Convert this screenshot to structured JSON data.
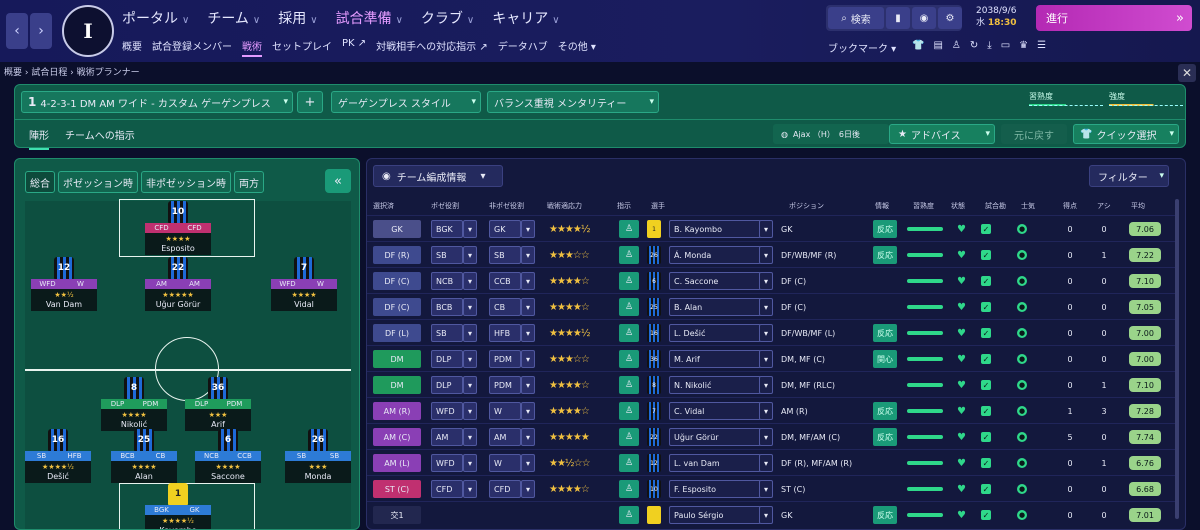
{
  "nav": {
    "back": "‹",
    "forward": "›",
    "club_logo_text": "I",
    "main": [
      {
        "label": "ポータル",
        "active": false
      },
      {
        "label": "チーム",
        "active": false
      },
      {
        "label": "採用",
        "active": false
      },
      {
        "label": "試合準備",
        "active": true
      },
      {
        "label": "クラブ",
        "active": false
      },
      {
        "label": "キャリア",
        "active": false
      }
    ],
    "sub": [
      {
        "label": "概要",
        "active": false
      },
      {
        "label": "試合登録メンバー",
        "active": false
      },
      {
        "label": "戦術",
        "active": true
      },
      {
        "label": "セットプレイ",
        "active": false
      },
      {
        "label": "PK ↗",
        "active": false
      },
      {
        "label": "対戦相手への対応指示 ↗",
        "active": false
      },
      {
        "label": "データハブ",
        "active": false
      },
      {
        "label": "その他 ▾",
        "active": false
      }
    ],
    "search_label": "検索",
    "date_line": "2038/9/6",
    "day": "水",
    "time": "18:30",
    "continue_label": "進行",
    "continue_arrow": "»",
    "bookmark_label": "ブックマーク ▾"
  },
  "breadcrumb": "概要 › 試合日程 › 戦術プランナー",
  "tactics": {
    "formation_num": "1",
    "formation": "4-2-3-1 DM AM ワイド - カスタム ゲーゲンプレス",
    "add": "+",
    "style": "ゲーゲンプレス  スタイル",
    "mentality": "バランス重視  メンタリティー",
    "familiarity_label": "習熟度",
    "strength_label": "強度",
    "tab_formation": "陣形",
    "tab_instructions": "チームへの指示",
    "opponent": "Ajax （H）　6日後",
    "advice": "アドバイス",
    "reset": "元に戻す",
    "quick_select": "クイック選択"
  },
  "pitch": {
    "tabs": [
      "総合",
      "ポゼッション時",
      "非ポゼッション時",
      "両方"
    ],
    "collapse": "«",
    "players": [
      {
        "num": "10",
        "r1": "CFD",
        "r2": "CFD",
        "stars": "★★★★",
        "name": "Esposito",
        "c": "red"
      },
      {
        "num": "12",
        "r1": "WFD",
        "r2": "W",
        "stars": "★★½",
        "name": "Van Dam",
        "c": "pur"
      },
      {
        "num": "22",
        "r1": "AM",
        "r2": "AM",
        "stars": "★★★★★",
        "name": "Uğur Görür",
        "c": "pur"
      },
      {
        "num": "7",
        "r1": "WFD",
        "r2": "W",
        "stars": "★★★★",
        "name": "Vidal",
        "c": "pur"
      },
      {
        "num": "8",
        "r1": "DLP",
        "r2": "PDM",
        "stars": "★★★★",
        "name": "Nikolić",
        "c": "grn"
      },
      {
        "num": "36",
        "r1": "DLP",
        "r2": "PDM",
        "stars": "★★★",
        "name": "Arif",
        "c": "grn"
      },
      {
        "num": "16",
        "r1": "SB",
        "r2": "HFB",
        "stars": "★★★★½",
        "name": "Dešić",
        "c": "blue"
      },
      {
        "num": "25",
        "r1": "BCB",
        "r2": "CB",
        "stars": "★★★★",
        "name": "Alan",
        "c": "blue"
      },
      {
        "num": "6",
        "r1": "NCB",
        "r2": "CCB",
        "stars": "★★★★",
        "name": "Saccone",
        "c": "blue"
      },
      {
        "num": "26",
        "r1": "SB",
        "r2": "SB",
        "stars": "★★★",
        "name": "Monda",
        "c": "blue"
      },
      {
        "num": "1",
        "r1": "BGK",
        "r2": "GK",
        "stars": "★★★★½",
        "name": "Kayombo",
        "c": "blue"
      }
    ]
  },
  "table": {
    "team_info": "チーム編成情報",
    "filter": "フィルター",
    "headers": [
      "選択済",
      "ポゼ役割",
      "非ポゼ役割",
      "戦術適応力",
      "指示",
      "選手",
      "ポジション",
      "情報",
      "習熟度",
      "状態",
      "試合勘",
      "士気",
      "得点",
      "アシ",
      "平均"
    ],
    "rows": [
      {
        "pos": "GK",
        "cls": "c-gk",
        "r1": "BGK",
        "r2": "GK",
        "stars": "★★★★½",
        "kit": "1",
        "gk": true,
        "name": "B. Kayombo",
        "ppos": "GK",
        "info": "反応",
        "g": "0",
        "a": "0",
        "avg": "7.06"
      },
      {
        "pos": "DF (R)",
        "cls": "c-df",
        "r1": "SB",
        "r2": "SB",
        "stars": "★★★☆☆",
        "kit": "26",
        "gk": false,
        "name": "Á. Monda",
        "ppos": "DF/WB/MF (R)",
        "info": "反応",
        "g": "0",
        "a": "1",
        "avg": "7.22"
      },
      {
        "pos": "DF (C)",
        "cls": "c-df",
        "r1": "NCB",
        "r2": "CCB",
        "stars": "★★★★☆",
        "kit": "6",
        "gk": false,
        "name": "C. Saccone",
        "ppos": "DF (C)",
        "info": "",
        "g": "0",
        "a": "0",
        "avg": "7.10"
      },
      {
        "pos": "DF (C)",
        "cls": "c-df",
        "r1": "BCB",
        "r2": "CB",
        "stars": "★★★★☆",
        "kit": "25",
        "gk": false,
        "name": "B. Alan",
        "ppos": "DF (C)",
        "info": "",
        "g": "0",
        "a": "0",
        "avg": "7.05"
      },
      {
        "pos": "DF (L)",
        "cls": "c-df",
        "r1": "SB",
        "r2": "HFB",
        "stars": "★★★★½",
        "kit": "16",
        "gk": false,
        "name": "L. Dešić",
        "ppos": "DF/WB/MF (L)",
        "info": "反応",
        "g": "0",
        "a": "0",
        "avg": "7.00"
      },
      {
        "pos": "DM",
        "cls": "c-dm",
        "r1": "DLP",
        "r2": "PDM",
        "stars": "★★★☆☆",
        "kit": "36",
        "gk": false,
        "name": "M. Arif",
        "ppos": "DM, MF (C)",
        "info": "関心",
        "g": "0",
        "a": "0",
        "avg": "7.00"
      },
      {
        "pos": "DM",
        "cls": "c-dm",
        "r1": "DLP",
        "r2": "PDM",
        "stars": "★★★★☆",
        "kit": "8",
        "gk": false,
        "name": "N. Nikolić",
        "ppos": "DM, MF (RLC)",
        "info": "",
        "g": "0",
        "a": "1",
        "avg": "7.10"
      },
      {
        "pos": "AM (R)",
        "cls": "c-am",
        "r1": "WFD",
        "r2": "W",
        "stars": "★★★★☆",
        "kit": "7",
        "gk": false,
        "name": "C. Vidal",
        "ppos": "AM (R)",
        "info": "反応",
        "g": "1",
        "a": "3",
        "avg": "7.28"
      },
      {
        "pos": "AM (C)",
        "cls": "c-am",
        "r1": "AM",
        "r2": "AM",
        "stars": "★★★★★",
        "kit": "22",
        "gk": false,
        "name": "Uğur Görür",
        "ppos": "DM, MF/AM (C)",
        "info": "反応",
        "g": "5",
        "a": "0",
        "avg": "7.74"
      },
      {
        "pos": "AM (L)",
        "cls": "c-am",
        "r1": "WFD",
        "r2": "W",
        "stars": "★★½☆☆",
        "kit": "12",
        "gk": false,
        "name": "L. van Dam",
        "ppos": "DF (R), MF/AM (R)",
        "info": "",
        "g": "0",
        "a": "1",
        "avg": "6.76"
      },
      {
        "pos": "ST (C)",
        "cls": "c-st",
        "r1": "CFD",
        "r2": "CFD",
        "stars": "★★★★☆",
        "kit": "10",
        "gk": false,
        "name": "F. Esposito",
        "ppos": "ST (C)",
        "info": "",
        "g": "0",
        "a": "0",
        "avg": "6.68"
      },
      {
        "pos": "交1",
        "cls": "c-sub",
        "r1": "",
        "r2": "",
        "stars": "",
        "kit": "",
        "gk": true,
        "name": "Paulo Sérgio",
        "ppos": "GK",
        "info": "反応",
        "g": "0",
        "a": "0",
        "avg": "7.01"
      }
    ]
  }
}
